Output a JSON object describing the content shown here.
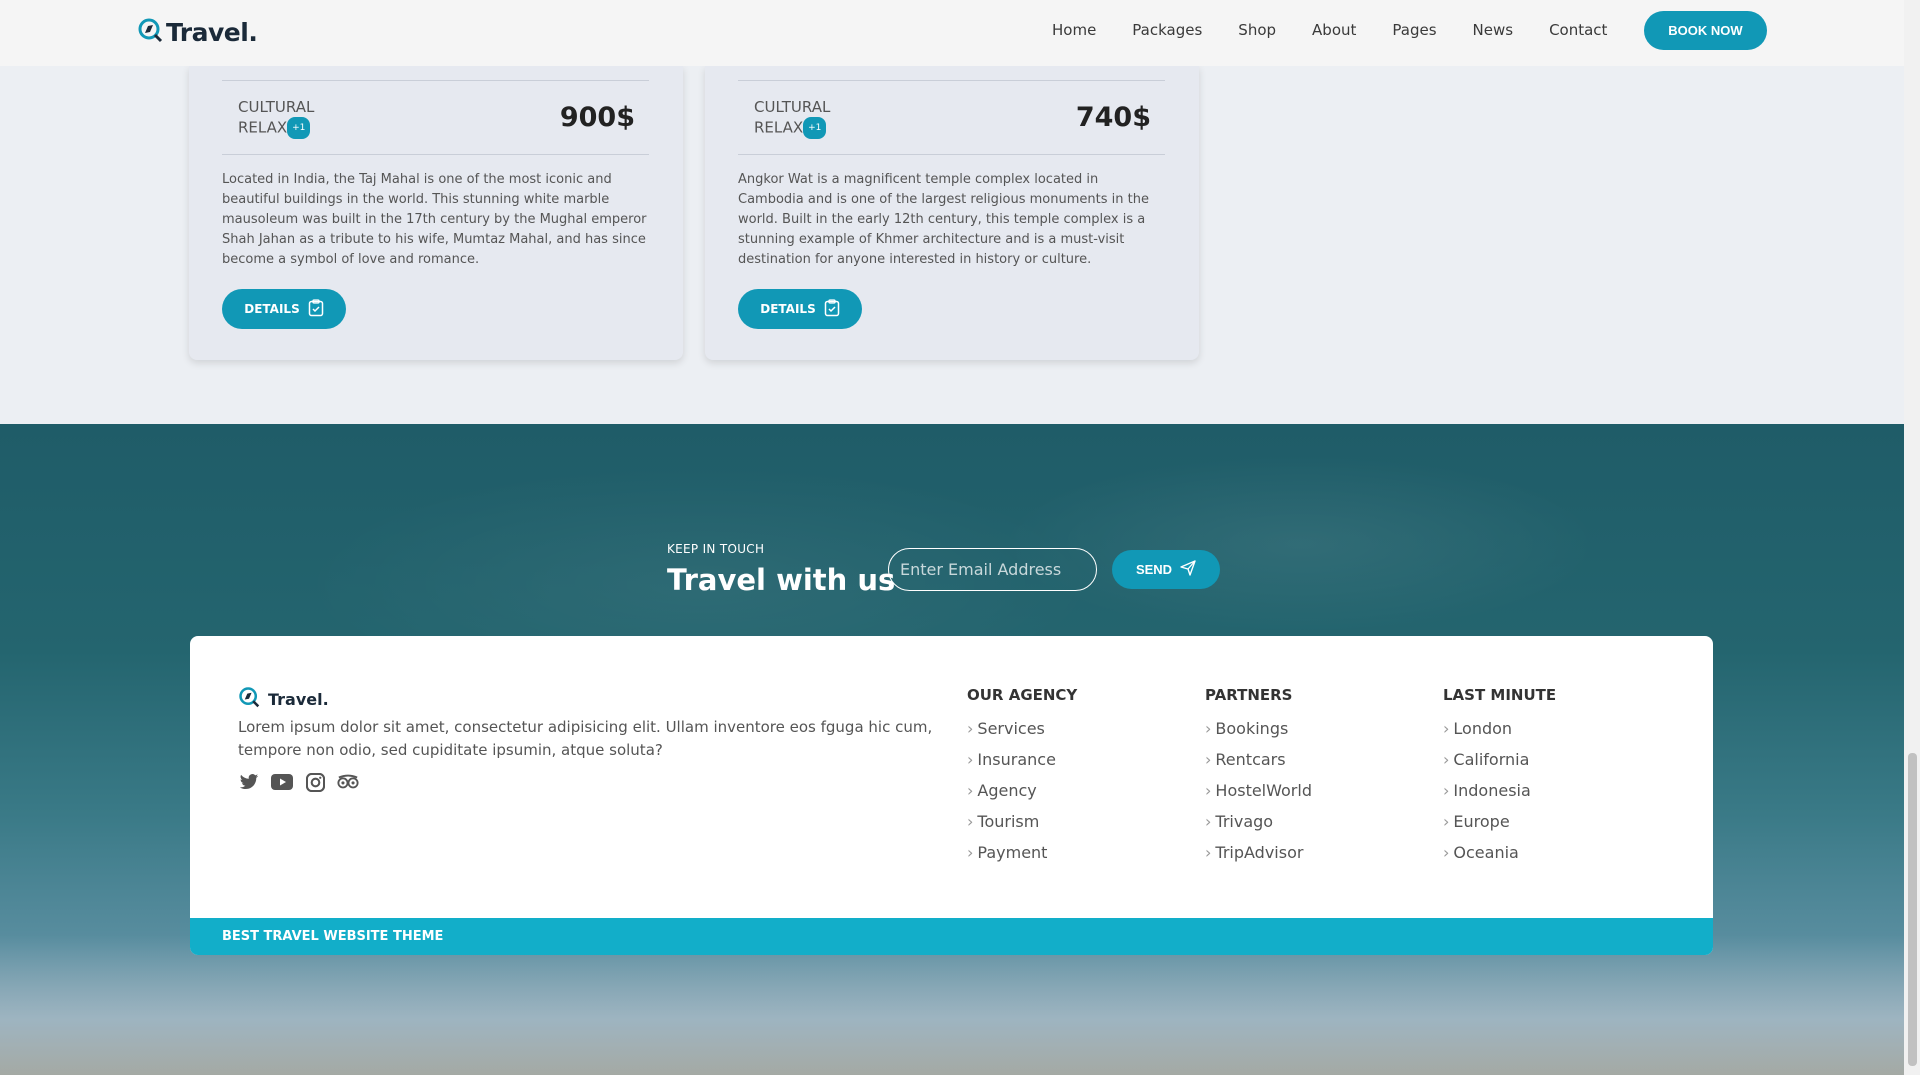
{
  "header": {
    "logo_text": "Travel.",
    "nav": [
      "Home",
      "Packages",
      "Shop",
      "About",
      "Pages",
      "News",
      "Contact"
    ],
    "cta": "BOOK NOW"
  },
  "cards": [
    {
      "tag_line1": "CULTURAL",
      "tag_line2": "RELAX",
      "tag_badge": "+1",
      "price": "900$",
      "description": "Located in India, the Taj Mahal is one of the most iconic and beautiful buildings in the world. This stunning white marble mausoleum was built in the 17th century by the Mughal emperor Shah Jahan as a tribute to his wife, Mumtaz Mahal, and has since become a symbol of love and romance.",
      "button": "DETAILS"
    },
    {
      "tag_line1": "CULTURAL",
      "tag_line2": "RELAX",
      "tag_badge": "+1",
      "price": "740$",
      "description": "Angkor Wat is a magnificent temple complex located in Cambodia and is one of the largest religious monuments in the world. Built in the early 12th century, this temple complex is a stunning example of Khmer architecture and is a must-visit destination for anyone interested in history or culture.",
      "button": "DETAILS"
    }
  ],
  "newsletter": {
    "kicker": "KEEP IN TOUCH",
    "title": "Travel with us",
    "placeholder": "Enter Email Address",
    "button": "SEND"
  },
  "footer": {
    "logo_text": "Travel.",
    "description": "Lorem ipsum dolor sit amet, consectetur adipisicing elit. Ullam inventore eos fguga hic cum, tempore non odio, sed cupiditate ipsumin, atque soluta?",
    "social_icons": [
      "twitter-icon",
      "youtube-icon",
      "instagram-icon",
      "tripadvisor-icon"
    ],
    "columns": [
      {
        "title": "OUR AGENCY",
        "items": [
          "Services",
          "Insurance",
          "Agency",
          "Tourism",
          "Payment"
        ]
      },
      {
        "title": "PARTNERS",
        "items": [
          "Bookings",
          "Rentcars",
          "HostelWorld",
          "Trivago",
          "TripAdvisor"
        ]
      },
      {
        "title": "LAST MINUTE",
        "items": [
          "London",
          "California",
          "Indonesia",
          "Europe",
          "Oceania"
        ]
      }
    ],
    "bar_text": "BEST TRAVEL WEBSITE THEME"
  },
  "colors": {
    "accent": "#1198b6",
    "bar": "#12aec9",
    "header_bg": "#f5f5f5"
  }
}
